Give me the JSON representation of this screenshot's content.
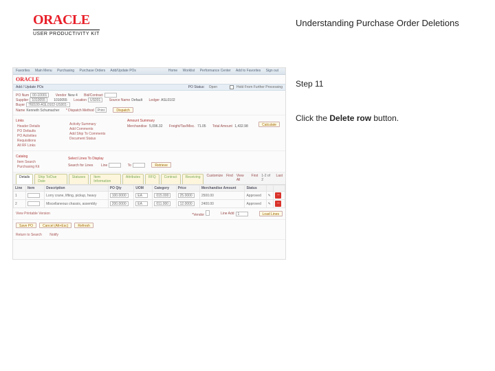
{
  "branding": {
    "logo": "ORACLE",
    "product": "USER PRODUCTIVITY KIT"
  },
  "guide": {
    "title": "Understanding Purchase Order Deletions",
    "step_label": "Step 11",
    "instruction_prefix": "Click the ",
    "instruction_bold": "Delete row",
    "instruction_suffix": " button."
  },
  "app": {
    "top_nav": {
      "left": [
        "Favorites",
        "Main Menu",
        "Purchasing",
        "Purchase Orders",
        "Add/Update POs"
      ],
      "right": [
        "Home",
        "Worklist",
        "Performance Center",
        "Add to Favorites",
        "Sign out"
      ]
    },
    "brand": "ORACLE",
    "page_heading": "Add / Update POs",
    "status_bar": {
      "po_status_label": "PO Status:",
      "po_status_value": "Open",
      "hold_label": "Hold From Further Processing"
    },
    "details": {
      "po_num_label": "PO Num",
      "po_num_value": "00-10001",
      "vendor_label": "Vendor",
      "vendor_value": "New 4",
      "bid_label": "Bid/Contract",
      "bid_value": "",
      "supplier_label": "Supplier",
      "supplier_value": "1010055",
      "location_label": "Location",
      "location_value": "US001",
      "source_name_label": "Source Name",
      "source_name_value": "Default",
      "ledger_label": "Ledger",
      "ledger_value": "ASL0102",
      "buyer_label": "Buyer",
      "buyer_value": "760100-ASL0102-US001-",
      "name_label": "Name",
      "name_value": "Kenneth Schumacher",
      "dispatch_label": "* Dispatch Method",
      "dispatch_value": "Print",
      "dispatch_btn": "Dispatch"
    },
    "links_left": {
      "header": "Links",
      "items": [
        "Header Details",
        "PO Defaults",
        "PO Activities",
        "Requisitions",
        "All RF Links"
      ]
    },
    "links_mid": {
      "items": [
        "Activity Summary",
        "Add Comments",
        "Add Ship To Comments",
        "Document Status"
      ]
    },
    "amount_summary": {
      "header": "Amount Summary",
      "rows": [
        {
          "k": "Merchandise",
          "v": "5,096.32"
        },
        {
          "k": "Freight/Tax/Misc.",
          "v": "71.05"
        },
        {
          "k": "Total Amount",
          "v": "1,432.98"
        }
      ],
      "calc_btn": "Calculate"
    },
    "select_lines": {
      "header": "Select Lines To Display",
      "search_label": "Search for Lines",
      "line_label": "Line",
      "to_label": "To",
      "retrieve_btn": "Retrieve"
    },
    "catalog": {
      "heading": "Catalog",
      "item": "Item Search",
      "purch": "Purchasing Kit"
    },
    "tabs": [
      "Details",
      "Ship To/Due Date",
      "Statuses",
      "Item Information",
      "Attributes",
      "RFQ",
      "Contract",
      "Receiving"
    ],
    "grid_controls": {
      "customize": "Customize",
      "find": "Find",
      "view": "View All",
      "first": "First",
      "range": "1-2 of 2",
      "last": "Last"
    },
    "grid": {
      "cols": [
        "Line",
        "Item",
        "Description",
        "PO Qty",
        "UOM",
        "Category",
        "Price",
        "Merchandise Amount",
        "Status"
      ],
      "rows": [
        {
          "line": "1",
          "item": "",
          "desc": "Lorry crane, lifting, pickup, heavy",
          "qty": "100.0000",
          "uom": "EA",
          "cat": "015.000",
          "price": "25.0000",
          "amt": "2500.00",
          "status": "Approved"
        },
        {
          "line": "2",
          "item": "",
          "desc": "Miscellaneous chassis, assembly",
          "qty": "200.0000",
          "uom": "EA",
          "cat": "011.000",
          "price": "12.0000",
          "amt": "2400.00",
          "status": "Approved"
        }
      ]
    },
    "row_actions": {
      "delete_title": "Delete row"
    },
    "grid_footer": {
      "view_printable": "View Printable Version",
      "vendor_label": "*Vendor",
      "line_add_label": "Line Add",
      "line_add_value": "1",
      "load_btn": "Load Lines"
    },
    "bottom_btns": {
      "save": "Save PO",
      "cancel": "Cancel (Alt+Esc)",
      "refresh": "Refresh"
    },
    "bottom_links": {
      "return": "Return to Search",
      "notify": "Notify"
    }
  }
}
